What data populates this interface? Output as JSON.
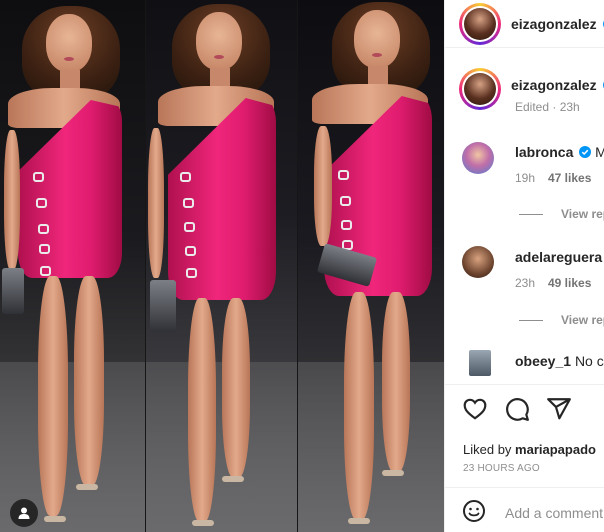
{
  "post": {
    "author": {
      "username": "eizagonzalez",
      "verified": true
    },
    "caption": {
      "username": "eizagonzalez",
      "edited_label": "Edited",
      "time_ago": "23h"
    }
  },
  "comments": [
    {
      "username": "labronca",
      "verified": true,
      "text": "M",
      "time_ago": "19h",
      "likes": "47 likes",
      "view_replies": "View rep"
    },
    {
      "username": "adelareguera",
      "verified": false,
      "text": "",
      "time_ago": "23h",
      "likes": "49 likes",
      "view_replies": "View rep"
    },
    {
      "username": "obeey_1",
      "verified": false,
      "text": "No ca",
      "time_ago": "",
      "likes": "",
      "view_replies": ""
    }
  ],
  "engagement": {
    "liked_by_prefix": "Liked by",
    "liked_by_user": "mariapapado",
    "timestamp": "23 HOURS AGO"
  },
  "comment_box": {
    "placeholder": "Add a comment"
  },
  "icons": {
    "like": "heart-icon",
    "comment": "comment-bubble-icon",
    "share": "paper-plane-icon",
    "emoji": "smiley-icon",
    "photo_tag": "user-tag-icon"
  },
  "colors": {
    "verified": "#0095f6",
    "dress": "#e8196f",
    "text_primary": "#262626",
    "text_secondary": "#8e8e8e"
  }
}
